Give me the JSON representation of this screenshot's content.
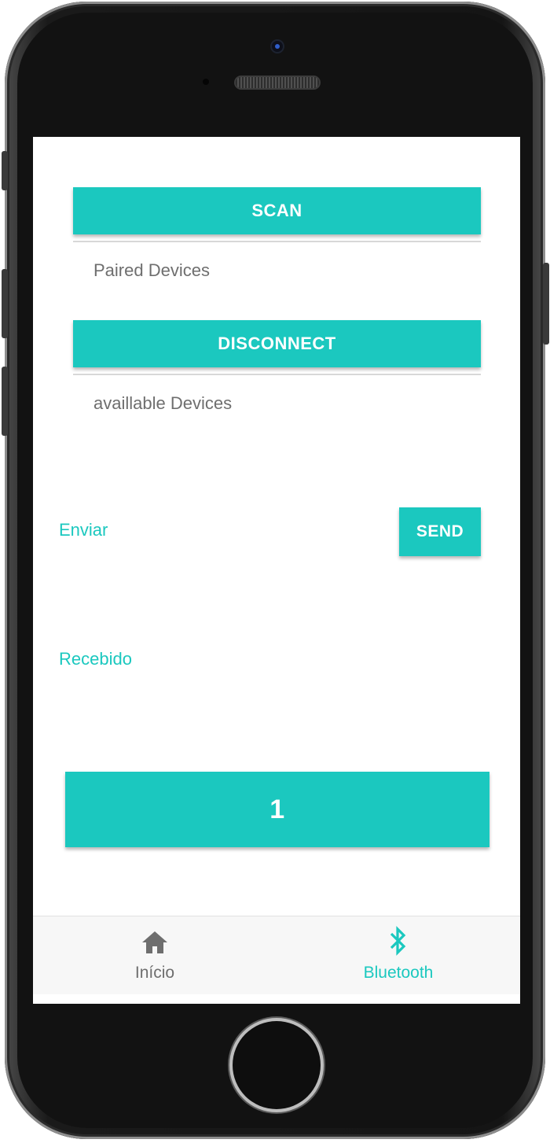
{
  "buttons": {
    "scan": "SCAN",
    "disconnect": "DISCONNECT",
    "send": "SEND",
    "counter": "1"
  },
  "lists": {
    "paired_label": "Paired Devices",
    "available_label": "availlable Devices"
  },
  "fields": {
    "send_label": "Enviar",
    "received_label": "Recebido"
  },
  "tabs": [
    {
      "label": "Início",
      "icon": "home-icon",
      "active": false
    },
    {
      "label": "Bluetooth",
      "icon": "bluetooth-icon",
      "active": true
    }
  ],
  "colors": {
    "accent": "#1bc8bf",
    "muted_text": "#6e6e6e"
  }
}
